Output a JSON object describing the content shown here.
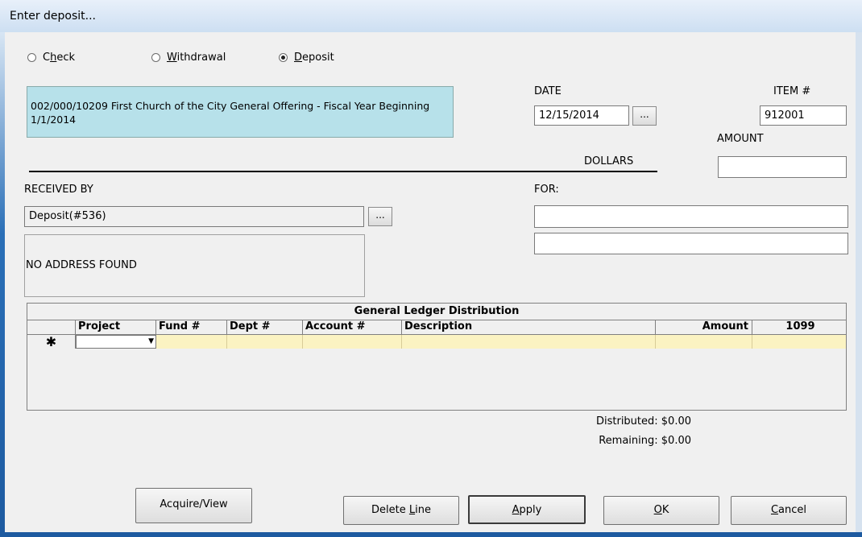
{
  "window": {
    "title": "Enter deposit..."
  },
  "type_radios": [
    {
      "label_prefix": "C",
      "label_underlined": "h",
      "label_rest": "eck",
      "selected": false
    },
    {
      "label_prefix": "",
      "label_underlined": "W",
      "label_rest": "ithdrawal",
      "selected": false
    },
    {
      "label_prefix": "",
      "label_underlined": "D",
      "label_rest": "eposit",
      "selected": true
    }
  ],
  "account": {
    "text": "002/000/10209 First Church of the City General Offering - Fiscal Year Beginning 1/1/2014"
  },
  "date": {
    "label": "DATE",
    "value": "12/15/2014",
    "browse": "..."
  },
  "item": {
    "label": "ITEM #",
    "value": "912001"
  },
  "amount": {
    "label": "AMOUNT",
    "value": ""
  },
  "dollars_label": "DOLLARS",
  "received_by": {
    "label": "RECEIVED BY",
    "value": "Deposit(#536)",
    "browse": "...",
    "address": "NO ADDRESS FOUND"
  },
  "for": {
    "label": "FOR:",
    "line1": "",
    "line2": ""
  },
  "ledger": {
    "title": "General Ledger Distribution",
    "columns": [
      "Project",
      "Fund #",
      "Dept #",
      "Account #",
      "Description",
      "Amount",
      "1099"
    ],
    "new_row_marker": "✱"
  },
  "totals": {
    "distributed": "Distributed: $0.00",
    "remaining": "Remaining: $0.00"
  },
  "buttons": {
    "acquire": "Acquire/View",
    "delete_prefix": "Delete ",
    "delete_u": "L",
    "delete_rest": "ine",
    "apply_u": "A",
    "apply_rest": "pply",
    "ok_u": "O",
    "ok_rest": "K",
    "cancel_u": "C",
    "cancel_rest": "ancel"
  }
}
